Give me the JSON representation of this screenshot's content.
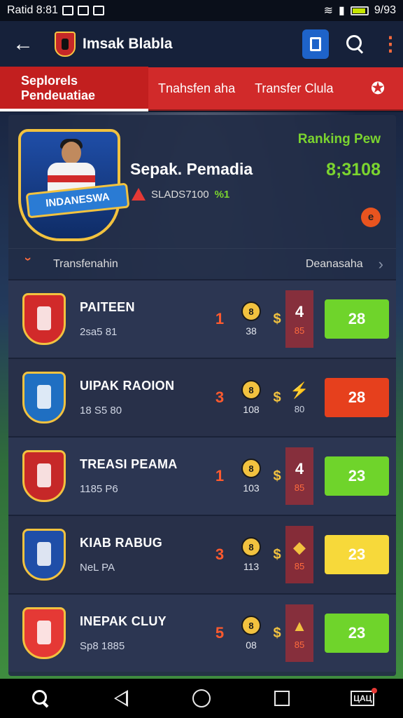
{
  "status_bar": {
    "left_text": "Ratid 8:81",
    "right_text": "9/93"
  },
  "app_bar": {
    "title": "Imsak Blabla"
  },
  "tabs": [
    {
      "label": "Seplorels Pendeuatiae",
      "active": true
    },
    {
      "label": "Tnahsfen aha",
      "active": false
    },
    {
      "label": "Transfer Clula",
      "active": false
    }
  ],
  "player": {
    "badge_text": "INDANESWA",
    "name": "Sepak. Pemadia",
    "warning_text": "SLADS7100",
    "warning_highlight": "%1",
    "ranking_label": "Ranking Pew",
    "ranking_value": "8;3108",
    "dot_label": "e"
  },
  "subbar": {
    "left": "Transfenahin",
    "right": "Deanasaha"
  },
  "clubs": [
    {
      "name": "PAITEEN",
      "sub": "2sa5 81",
      "pos": "1",
      "coin": "8",
      "coin_val": "38",
      "form_top": "4",
      "form_bot": "85",
      "score": "28",
      "score_color": "#6fd42b",
      "badge_color": "#d12a2a"
    },
    {
      "name": "UIPAK RAOION",
      "sub": "18 S5 80",
      "pos": "3",
      "coin": "8",
      "coin_val": "108",
      "form_top": "⚡",
      "form_bot": "80",
      "score": "28",
      "score_color": "#e6401d",
      "badge_color": "#1f6fc2"
    },
    {
      "name": "TREASI PEAMA",
      "sub": "1185 P6",
      "pos": "1",
      "coin": "8",
      "coin_val": "103",
      "form_top": "4",
      "form_bot": "85",
      "score": "23",
      "score_color": "#6fd42b",
      "badge_color": "#c62828"
    },
    {
      "name": "KIAB RABUG",
      "sub": "NeL PA",
      "pos": "3",
      "coin": "8",
      "coin_val": "113",
      "form_top": "◆",
      "form_bot": "85",
      "score": "23",
      "score_color": "#f7d93a",
      "badge_color": "#1f4ea8"
    },
    {
      "name": "INEPAK CLUY",
      "sub": "Sp8 1885",
      "pos": "5",
      "coin": "8",
      "coin_val": "08",
      "form_top": "▲",
      "form_bot": "85",
      "score": "23",
      "score_color": "#6fd42b",
      "badge_color": "#e53935"
    }
  ],
  "nav_bar": {
    "app_label": "ЦАЦ"
  }
}
